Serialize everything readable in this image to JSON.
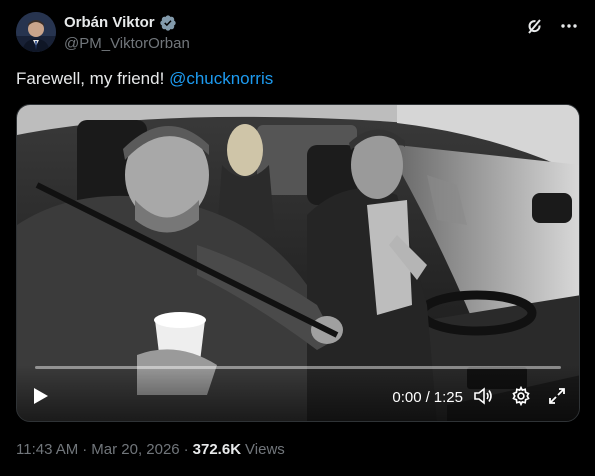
{
  "author": {
    "display_name": "Orbán Viktor",
    "handle": "@PM_ViktorOrban",
    "verified": true,
    "avatar_icon": "profile-photo"
  },
  "header_actions": [
    {
      "icon": "grok-icon"
    },
    {
      "icon": "more-icon"
    }
  ],
  "tweet": {
    "text": "Farewell, my friend!",
    "mention": "@chucknorris"
  },
  "video": {
    "current_time": "0:00",
    "separator": "/",
    "duration": "1:25",
    "progress_fraction": 0,
    "controls": [
      "play-icon",
      "volume-icon",
      "settings-icon",
      "fullscreen-icon"
    ]
  },
  "meta": {
    "time": "11:43 AM",
    "separator": "·",
    "date": "Mar 20, 2026",
    "separator2": "·",
    "views_count": "372.6K",
    "views_label": "Views"
  },
  "colors": {
    "accent": "#1d9bf0",
    "secondary_text": "#71767b",
    "primary_text": "#e7e9ea",
    "background": "#000000"
  }
}
